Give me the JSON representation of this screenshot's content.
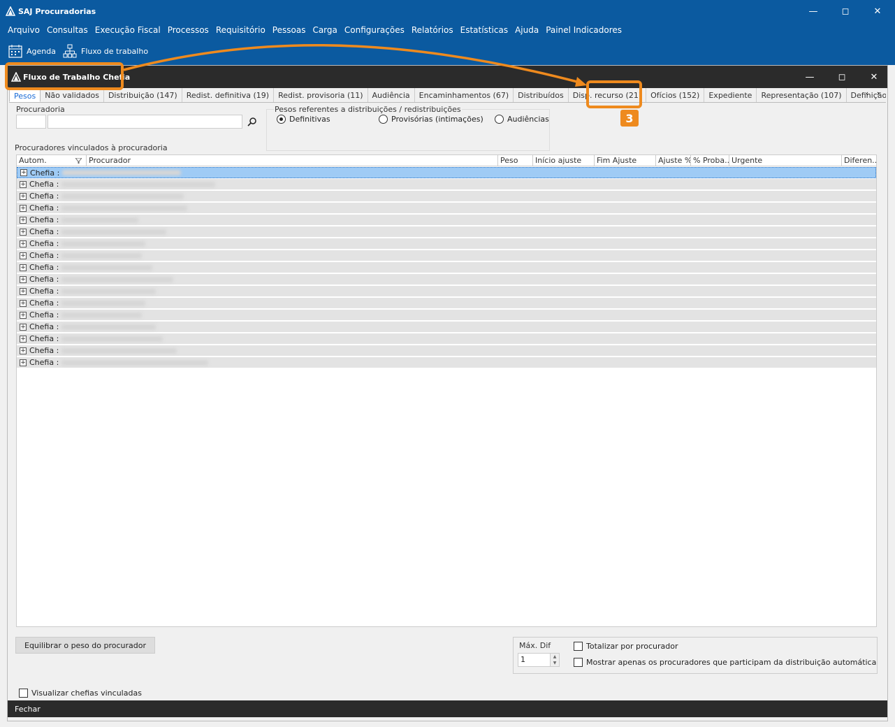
{
  "app": {
    "title": "SAJ Procuradorias"
  },
  "menu": [
    "Arquivo",
    "Consultas",
    "Execução Fiscal",
    "Processos",
    "Requisitório",
    "Pessoas",
    "Carga",
    "Configurações",
    "Relatórios",
    "Estatísticas",
    "Ajuda",
    "Painel Indicadores"
  ],
  "toolbar": {
    "agenda": "Agenda",
    "fluxo": "Fluxo de trabalho"
  },
  "child": {
    "title": "Fluxo de Trabalho Chefia"
  },
  "tabs": [
    "Pesos",
    "Não validados",
    "Distribuição (147)",
    "Redist. definitiva (19)",
    "Redist. provisoria (11)",
    "Audiência",
    "Encaminhamentos (67)",
    "Distribuídos",
    "Disp. recurso (21)",
    "Ofícios (152)",
    "Expediente",
    "Representação (107)",
    "Definição de Polo de Atu"
  ],
  "filter": {
    "procuradoria_label": "Procuradoria",
    "pesos_label": "Pesos referentes a distribuições / redistribuições",
    "radios": [
      "Definitivas",
      "Provisórias (intimações)",
      "Audiências"
    ]
  },
  "grid": {
    "title": "Procuradores vinculados à procuradoria",
    "columns": [
      "Autom.",
      "Procurador",
      "Peso",
      "Início ajuste",
      "Fim Ajuste",
      "Ajuste %",
      "% Proba...",
      "Urgente",
      "Diferen..."
    ],
    "row_label": "Chefia :"
  },
  "bottom": {
    "equilibrar": "Equilibrar o peso do procurador",
    "max_dif_label": "Máx. Dif",
    "max_dif_value": "1",
    "totalizar": "Totalizar por procurador",
    "mostrar": "Mostrar apenas os procuradores que participam da distribuição automática",
    "visualizar": "Visualizar chefias vinculadas",
    "fechar": "Fechar"
  },
  "annotation": {
    "badge": "3"
  }
}
